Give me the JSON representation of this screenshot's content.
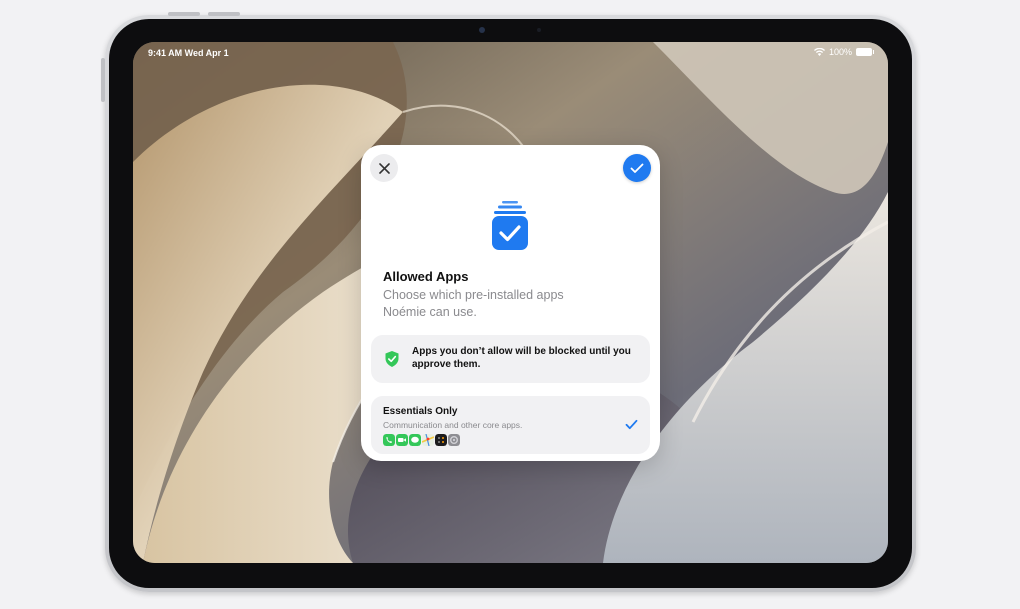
{
  "status_bar": {
    "time_date": "9:41 AM  Wed Apr 1",
    "battery": "100%",
    "wifi_icon": "wifi-icon",
    "battery_icon": "battery-icon"
  },
  "sheet": {
    "close_icon": "close-icon",
    "done_icon": "checkmark-icon",
    "app_icon": "allowed-apps-icon",
    "title": "Allowed Apps",
    "subtitle": "Choose which pre-installed apps Noémie can use.",
    "notice": {
      "icon": "shield-check-icon",
      "text": "Apps you don’t allow will be blocked until you approve them."
    },
    "option": {
      "title": "Essentials Only",
      "description": "Communication and other core apps.",
      "selected": true,
      "app_icons": [
        "phone-icon",
        "facetime-icon",
        "messages-icon",
        "maps-icon",
        "calculator-icon",
        "settings-icon"
      ]
    }
  },
  "colors": {
    "accent": "#1f7af0",
    "shield": "#34c759"
  }
}
